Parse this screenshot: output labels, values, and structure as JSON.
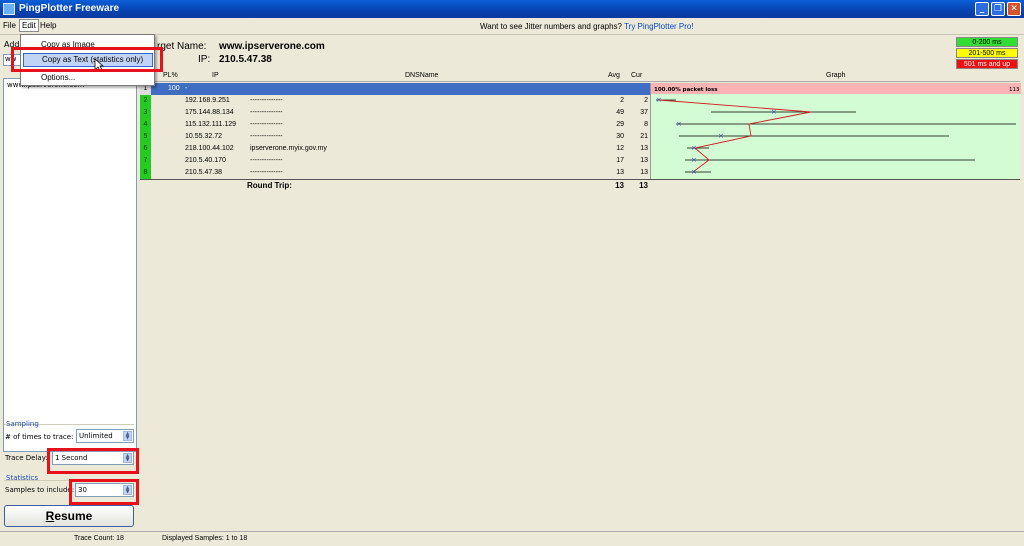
{
  "window": {
    "title": "PingPlotter Freeware"
  },
  "menu": {
    "file": "File",
    "edit": "Edit",
    "help": "Help"
  },
  "promo": {
    "text": "Want to see Jitter numbers and graphs?",
    "link": "Try PingPlotter Pro!"
  },
  "edit_menu": {
    "copy_image": "Copy as Image",
    "copy_text": "Copy as Text (statistics only)",
    "options": "Options..."
  },
  "left": {
    "address_label": "Addr",
    "address_value": "ww",
    "host_entry": "www.ipserverone.com",
    "sampling_label": "Sampling",
    "times_label": "# of times to trace:",
    "times_value": "Unlimited",
    "delay_label": "Trace Delay:",
    "delay_value": "1 Second",
    "statistics_label": "Statistics",
    "samples_label": "Samples to include:",
    "samples_value": "30",
    "resume_first": "R",
    "resume_rest": "esume"
  },
  "target": {
    "name_label": "rget Name:",
    "name_value": "www.ipserverone.com",
    "ip_label": "IP:",
    "ip_value": "210.5.47.38"
  },
  "legend": [
    {
      "text": "0-200 ms",
      "color": "#33dd33"
    },
    {
      "text": "201-500 ms",
      "color": "#ffff00"
    },
    {
      "text": "501 ms and up",
      "color": "#ee1111"
    }
  ],
  "columns": {
    "pl": "PL%",
    "ip": "IP",
    "dns": "DNSName",
    "avg": "Avg",
    "cur": "Cur",
    "graph": "Graph"
  },
  "hops": [
    {
      "num": "1",
      "pl": "100",
      "ip": "-",
      "dns": "",
      "avg": "",
      "cur": ""
    },
    {
      "num": "2",
      "pl": "",
      "ip": "192.168.9.251",
      "dns": "--------------",
      "avg": "2",
      "cur": "2"
    },
    {
      "num": "3",
      "pl": "",
      "ip": "175.144.88.134",
      "dns": "--------------",
      "avg": "49",
      "cur": "37"
    },
    {
      "num": "4",
      "pl": "",
      "ip": "115.132.111.129",
      "dns": "--------------",
      "avg": "29",
      "cur": "8"
    },
    {
      "num": "5",
      "pl": "",
      "ip": "10.55.32.72",
      "dns": "--------------",
      "avg": "30",
      "cur": "21"
    },
    {
      "num": "6",
      "pl": "",
      "ip": "218.100.44.102",
      "dns": "ipserverone.myix.gov.my",
      "avg": "12",
      "cur": "13"
    },
    {
      "num": "7",
      "pl": "",
      "ip": "210.5.40.170",
      "dns": "--------------",
      "avg": "17",
      "cur": "13"
    },
    {
      "num": "8",
      "pl": "",
      "ip": "210.5.47.38",
      "dns": "--------------",
      "avg": "13",
      "cur": "13"
    }
  ],
  "graph": {
    "loss_text": "100.00% packet loss",
    "loss_end": "113"
  },
  "roundtrip": {
    "label": "Round Trip:",
    "avg": "13",
    "cur": "13"
  },
  "status": {
    "trace_count": "Trace Count: 18",
    "displayed": "Displayed Samples: 1 to 18"
  }
}
